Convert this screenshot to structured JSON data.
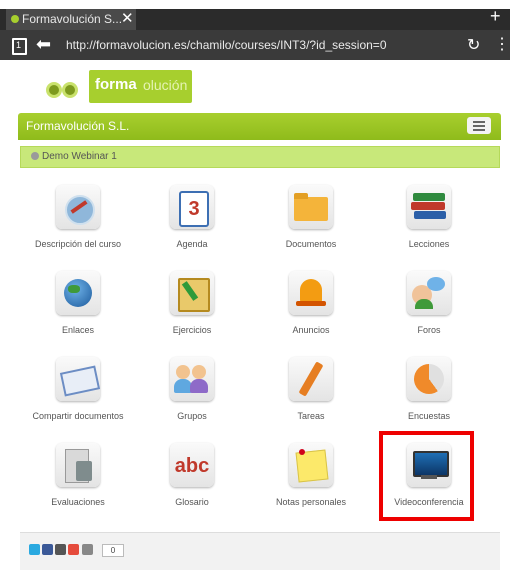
{
  "browser": {
    "tab_title": "Formavolución S...",
    "tab_close": "✕",
    "new_tab": "+",
    "tabs_count": "1",
    "back": "⬅",
    "url": "http://formavolucion.es/chamilo/courses/INT3/?id_session=0",
    "reload": "↻",
    "menu": "⋮"
  },
  "logo": {
    "part1": "forma",
    "part2": "olución"
  },
  "navbar": {
    "brand": "Formavolución S.L."
  },
  "breadcrumb": {
    "course": "Demo Webinar 1"
  },
  "tools": [
    {
      "label": "Descripción del curso",
      "icon": "description-icon"
    },
    {
      "label": "Agenda",
      "icon": "calendar-icon",
      "glyph": "3"
    },
    {
      "label": "Documentos",
      "icon": "folder-icon"
    },
    {
      "label": "Lecciones",
      "icon": "books-icon"
    },
    {
      "label": "Enlaces",
      "icon": "globe-icon"
    },
    {
      "label": "Ejercicios",
      "icon": "exercise-icon"
    },
    {
      "label": "Anuncios",
      "icon": "bell-icon"
    },
    {
      "label": "Foros",
      "icon": "forum-icon"
    },
    {
      "label": "Compartir documentos",
      "icon": "envelope-icon"
    },
    {
      "label": "Grupos",
      "icon": "groups-icon"
    },
    {
      "label": "Tareas",
      "icon": "pencil-icon"
    },
    {
      "label": "Encuestas",
      "icon": "survey-icon"
    },
    {
      "label": "Evaluaciones",
      "icon": "calculator-icon"
    },
    {
      "label": "Glosario",
      "icon": "glossary-icon",
      "glyph": "abc"
    },
    {
      "label": "Notas personales",
      "icon": "note-icon"
    },
    {
      "label": "Videoconferencia",
      "icon": "monitor-icon"
    }
  ],
  "footer": {
    "share_count": "0"
  },
  "colors": {
    "brand_green": "#a7cf2e",
    "breadcrumb_green": "#c8e87a",
    "highlight_red": "#ee0000"
  }
}
